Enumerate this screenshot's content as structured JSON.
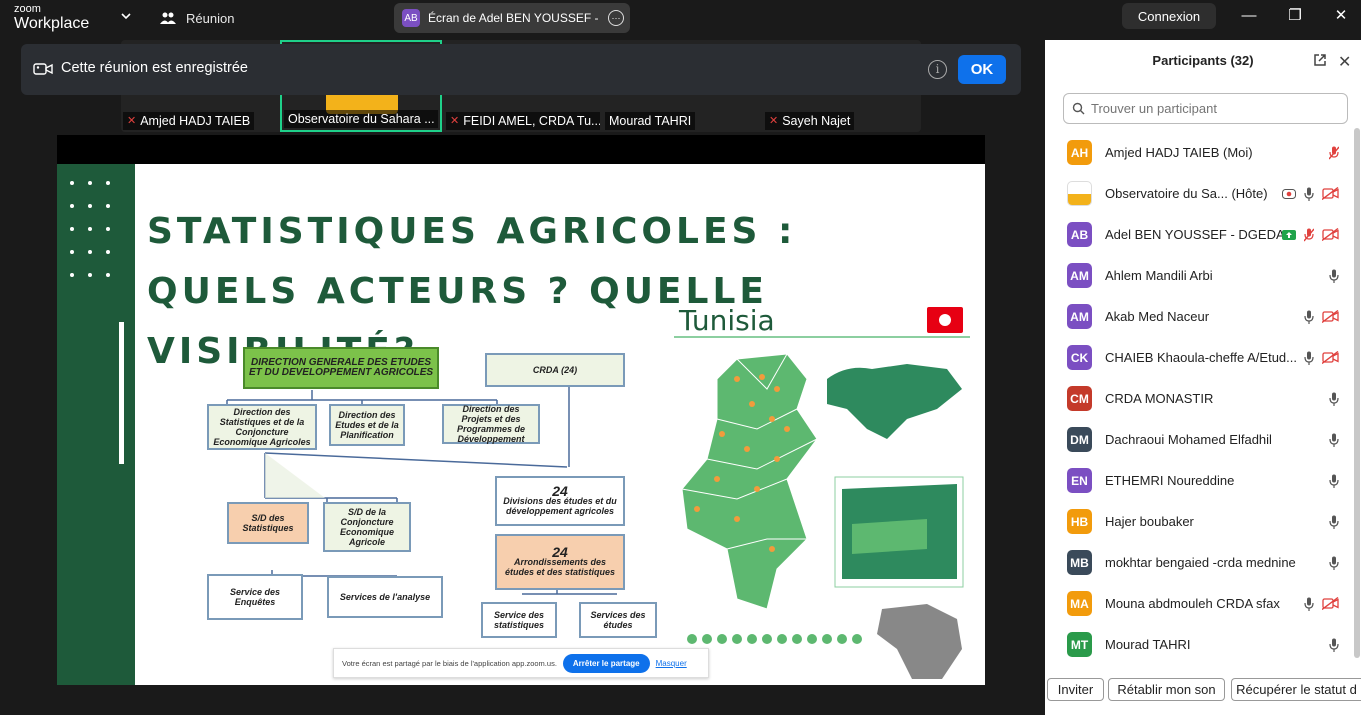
{
  "app": {
    "logo_top": "zoom",
    "logo_bottom": "Workplace"
  },
  "titlebar": {
    "meeting_label": "Réunion",
    "share_tab_avatar": "AB",
    "share_tab_text": "Écran de Adel BEN YOUSSEF - DGEDA",
    "connexion_label": "Connexion"
  },
  "thumbnails": [
    {
      "name": "Amjed HADJ TAIEB",
      "muted": true
    },
    {
      "name": "Observatoire du Sahara ...",
      "muted": false
    },
    {
      "name": "FEIDI AMEL, CRDA Tu...",
      "muted": true
    },
    {
      "name": "Mourad TAHRI",
      "muted": false
    },
    {
      "name": "Sayeh Najet",
      "muted": true
    }
  ],
  "banner": {
    "text": "Cette réunion est enregistrée",
    "ok_label": "OK",
    "info_glyph": "i"
  },
  "slide": {
    "title": "STATISTIQUES AGRICOLES : QUELS ACTEURS ? QUELLE VISIBILITÉ?",
    "country_label": "Tunisia",
    "org": {
      "direction_generale": "DIRECTION GENERALE DES ETUDES ET DU DEVELOPPEMENT AGRICOLES",
      "crda": "CRDA (24)",
      "dir_stats": "Direction des Statistiques et de la Conjoncture Economique Agricoles",
      "dir_etudes": "Direction des Etudes et de la Planification",
      "dir_projets": "Direction des Projets et des Programmes de Développement",
      "div_num": "24",
      "div_label": "Divisions des études et du développement agricoles",
      "arr_num": "24",
      "arr_label": "Arrondissements des études et des statistiques",
      "sd_stats": "S/D des Statistiques",
      "sd_conj": "S/D de la Conjoncture Economique Agricole",
      "serv_enq": "Service des Enquêtes",
      "serv_analyse": "Services de l'analyse",
      "serv_stats": "Service des statistiques",
      "serv_etudes": "Services des études"
    },
    "notice": {
      "text": "Votre écran est partagé par le biais de l'application app.zoom.us.",
      "button": "Arrêter le partage",
      "link": "Masquer"
    }
  },
  "panel": {
    "title": "Participants (32)",
    "search_placeholder": "Trouver un participant",
    "participants": [
      {
        "initials": "AH",
        "name": "Amjed HADJ TAIEB (Moi)",
        "color": "#f29b0c",
        "mic": "off",
        "video": "none"
      },
      {
        "initials": "",
        "name": "Observatoire du Sa...  (Hôte)",
        "color": "#f3b21a",
        "mic": "on",
        "video": "off",
        "record": true
      },
      {
        "initials": "AB",
        "name": "Adel BEN YOUSSEF - DGEDA",
        "color": "#7b4fc2",
        "mic": "off",
        "video": "off",
        "sharing": true
      },
      {
        "initials": "AM",
        "name": "Ahlem Mandili Arbi",
        "color": "#7b4fc2",
        "mic": "on",
        "video": "none"
      },
      {
        "initials": "AM",
        "name": "Akab Med Naceur",
        "color": "#7b4fc2",
        "mic": "on",
        "video": "off"
      },
      {
        "initials": "CK",
        "name": "CHAIEB Khaoula-cheffe A/Etud...",
        "color": "#7b4fc2",
        "mic": "on",
        "video": "off"
      },
      {
        "initials": "CM",
        "name": "CRDA MONASTIR",
        "color": "#c43a2a",
        "mic": "on",
        "video": "none"
      },
      {
        "initials": "DM",
        "name": "Dachraoui Mohamed Elfadhil",
        "color": "#3a4a5a",
        "mic": "on",
        "video": "none"
      },
      {
        "initials": "EN",
        "name": "ETHEMRI Noureddine",
        "color": "#7b4fc2",
        "mic": "on",
        "video": "none"
      },
      {
        "initials": "HB",
        "name": "Hajer boubaker",
        "color": "#f29b0c",
        "mic": "on",
        "video": "none"
      },
      {
        "initials": "MB",
        "name": "mokhtar bengaied -crda mednine",
        "color": "#3a4a5a",
        "mic": "on",
        "video": "none"
      },
      {
        "initials": "MA",
        "name": "Mouna abdmouleh CRDA sfax",
        "color": "#f29b0c",
        "mic": "on",
        "video": "off"
      },
      {
        "initials": "MT",
        "name": "Mourad TAHRI",
        "color": "#2a9a4a",
        "mic": "on",
        "video": "none"
      }
    ],
    "footer": {
      "invite": "Inviter",
      "restore": "Rétablir mon son",
      "recover": "Récupérer le statut d"
    }
  }
}
